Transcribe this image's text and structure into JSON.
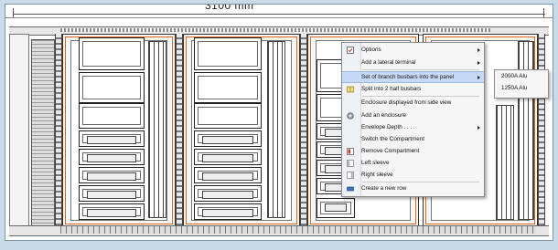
{
  "drawing": {
    "dimension_text": "3100 mm"
  },
  "context_menu": {
    "items": [
      {
        "label": "Options",
        "icon": "options-icon",
        "submenu": true
      },
      {
        "label": "Add a lateral terminal",
        "icon": "",
        "submenu": true
      },
      {
        "label": "Set of branch busbars into the panel",
        "icon": "",
        "submenu": true,
        "selected": true
      },
      {
        "label": "Split into 2 half busbars",
        "icon": "split-busbar-icon",
        "submenu": false
      },
      {
        "label": "Enclosure displayed from side view",
        "icon": "",
        "submenu": false
      },
      {
        "label": "Add an enclosure",
        "icon": "enclosure-icon",
        "submenu": false
      },
      {
        "label": "Envelope Depth . . . .",
        "icon": "",
        "submenu": true
      },
      {
        "label": "Switch the Compartment",
        "icon": "",
        "submenu": false
      },
      {
        "label": "Remove Compartment",
        "icon": "remove-compartment-icon",
        "submenu": false
      },
      {
        "label": "Left sleeve",
        "icon": "left-sleeve-icon",
        "submenu": false
      },
      {
        "label": "Right sleeve",
        "icon": "right-sleeve-icon",
        "submenu": false
      },
      {
        "label": "Create a new row",
        "icon": "new-row-icon",
        "submenu": false
      }
    ]
  },
  "submenu": {
    "items": [
      "2000A Alu",
      "1250A Alu"
    ]
  },
  "colors": {
    "selection": "#c6d9f7",
    "frame_accent": "#e0651d",
    "background": "#c9dbe9"
  }
}
